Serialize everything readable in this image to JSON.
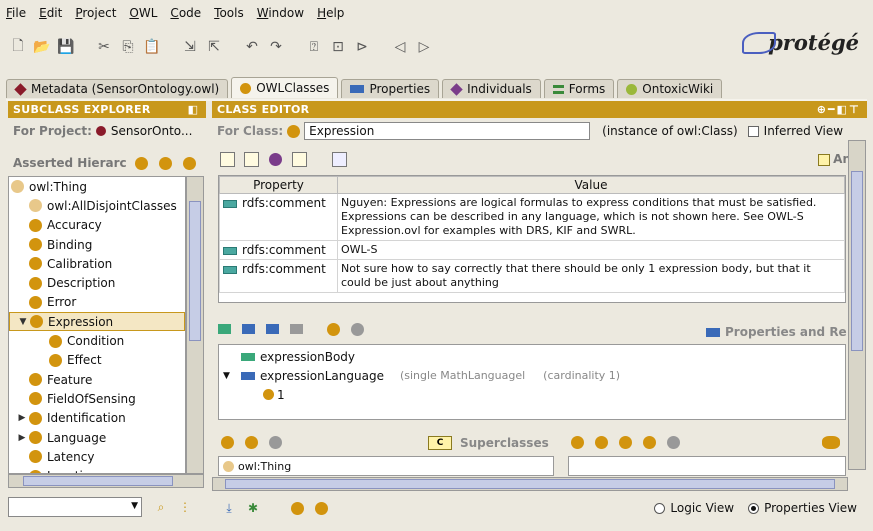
{
  "menubar": [
    "File",
    "Edit",
    "Project",
    "OWL",
    "Code",
    "Tools",
    "Window",
    "Help"
  ],
  "logo": "protégé",
  "tabs": [
    {
      "label": "Metadata (SensorOntology.owl)",
      "color": "#8a1a2a",
      "shape": "diamond",
      "active": false
    },
    {
      "label": "OWLClasses",
      "color": "#d2940e",
      "shape": "circle",
      "active": true
    },
    {
      "label": "Properties",
      "color": "#3a6ab8",
      "shape": "rect",
      "active": false
    },
    {
      "label": "Individuals",
      "color": "#7a3c8a",
      "shape": "diamond",
      "active": false
    },
    {
      "label": "Forms",
      "color": "#3a8a3a",
      "shape": "lines",
      "active": false
    },
    {
      "label": "OntoxicWiki",
      "color": "#9ab83a",
      "shape": "circle",
      "active": false
    }
  ],
  "left_panel": {
    "header": "SUBCLASS EXPLORER",
    "for_project_label": "For Project:",
    "project_name": "SensorOnto...",
    "asserted_label": "Asserted Hierarc",
    "tree": [
      {
        "label": "owl:Thing",
        "indent": 0,
        "toggle": "",
        "light": true
      },
      {
        "label": "owl:AllDisjointClasses",
        "indent": 1,
        "toggle": "",
        "light": true
      },
      {
        "label": "Accuracy",
        "indent": 1,
        "toggle": ""
      },
      {
        "label": "Binding",
        "indent": 1,
        "toggle": ""
      },
      {
        "label": "Calibration",
        "indent": 1,
        "toggle": ""
      },
      {
        "label": "Description",
        "indent": 1,
        "toggle": ""
      },
      {
        "label": "Error",
        "indent": 1,
        "toggle": ""
      },
      {
        "label": "Expression",
        "indent": 1,
        "toggle": "▼",
        "selected": true
      },
      {
        "label": "Condition",
        "indent": 2,
        "toggle": ""
      },
      {
        "label": "Effect",
        "indent": 2,
        "toggle": ""
      },
      {
        "label": "Feature",
        "indent": 1,
        "toggle": ""
      },
      {
        "label": "FieldOfSensing",
        "indent": 1,
        "toggle": ""
      },
      {
        "label": "Identification",
        "indent": 1,
        "toggle": "▶"
      },
      {
        "label": "Language",
        "indent": 1,
        "toggle": "▶"
      },
      {
        "label": "Latency",
        "indent": 1,
        "toggle": ""
      },
      {
        "label": "Location",
        "indent": 1,
        "toggle": ""
      }
    ]
  },
  "right_panel": {
    "header": "CLASS EDITOR",
    "for_class_label": "For Class:",
    "class_name": "Expression",
    "instance_label": "(instance of owl:Class)",
    "inferred_label": "Inferred View",
    "annotations_label": "An",
    "annotations": {
      "columns": [
        "Property",
        "Value"
      ],
      "rows": [
        {
          "property": "rdfs:comment",
          "value": "Nguyen: Expressions are logical formulas to express conditions that must be satisfied. Expressions can be described in any language, which is not shown here. See OWL-S Expression.ovl for examples with DRS, KIF and SWRL."
        },
        {
          "property": "rdfs:comment",
          "value": "OWL-S"
        },
        {
          "property": "rdfs:comment",
          "value": "Not sure how to say correctly that there should be only 1 expression body, but that it could be just about anything"
        }
      ]
    },
    "properties_label": "Properties and Re",
    "properties": [
      {
        "name": "expressionBody",
        "color": "#3aa87a"
      },
      {
        "name": "expressionLanguage",
        "color": "#3a6ab8",
        "detail": "(single MathLanguagel",
        "cardinality": "(cardinality 1)"
      }
    ],
    "property_value": "1",
    "superclasses_label": "Superclasses",
    "superclasses_icon_text": "C",
    "superclasses": [
      "owl:Thing"
    ],
    "view_options": {
      "logic": "Logic View",
      "properties": "Properties View",
      "selected": "properties"
    }
  },
  "colors": {
    "header": "#c8981c",
    "class_dot": "#d2940e",
    "selection": "#f4e7c4"
  }
}
